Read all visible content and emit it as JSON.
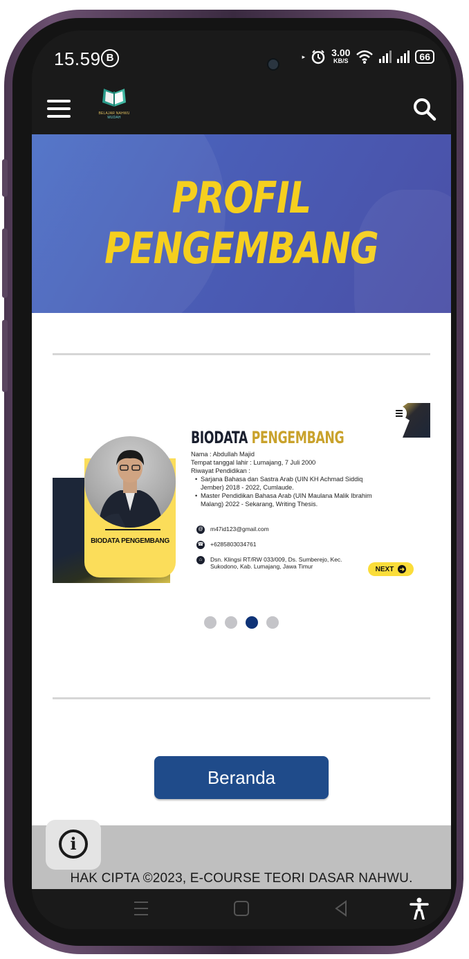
{
  "status_bar": {
    "time": "15.59",
    "notif_badge": "B",
    "speed_value": "3.00",
    "speed_unit": "KB/S",
    "battery": "66"
  },
  "app_bar": {
    "logo_line1": "BELAJAR NAHWU",
    "logo_line2": "MUDAH",
    "menu_icon": "hamburger-menu-icon",
    "search_icon": "search-icon"
  },
  "banner": {
    "title": "PROFIL PENGEMBANG"
  },
  "slide": {
    "card_label": "BIODATA PENGEMBANG",
    "title_part1": "BIODATA ",
    "title_part2": "PENGEMBANG",
    "name_line": "Nama : Abdullah Majid",
    "birth_line": "Tempat tanggal lahir : Lumajang, 7 Juli 2000",
    "edu_heading": "Riwayat Pendidikan :",
    "edu_items": [
      "Sarjana Bahasa dan Sastra Arab (UIN KH Achmad Siddiq Jember) 2018 - 2022, Cumlaude.",
      "Master Pendidikan Bahasa Arab (UIN Maulana Malik Ibrahim Malang) 2022 - Sekarang, Writing Thesis."
    ],
    "email": "m47id123@gmail.com",
    "phone": "+6285803034761",
    "address": "Dsn. Klingsi RT/RW 033/009, Ds. Sumberejo, Kec. Sukodono, Kab. Lumajang, Jawa Timur",
    "next_label": "NEXT",
    "colors": {
      "navy": "#1c2638",
      "gold": "#c9a22c",
      "yellow": "#fbdd5a"
    }
  },
  "carousel": {
    "total_slides": 4,
    "active_slide": 3
  },
  "home_button": {
    "label": "Beranda",
    "color": "#1f4b8a"
  },
  "footer": {
    "copyright": "HAK CIPTA ©2023, E-COURSE TEORI DASAR NAHWU.",
    "info_icon": "info-icon"
  },
  "nav_bar": {
    "items": [
      "recents-icon",
      "home-icon",
      "back-icon",
      "accessibility-icon"
    ]
  }
}
